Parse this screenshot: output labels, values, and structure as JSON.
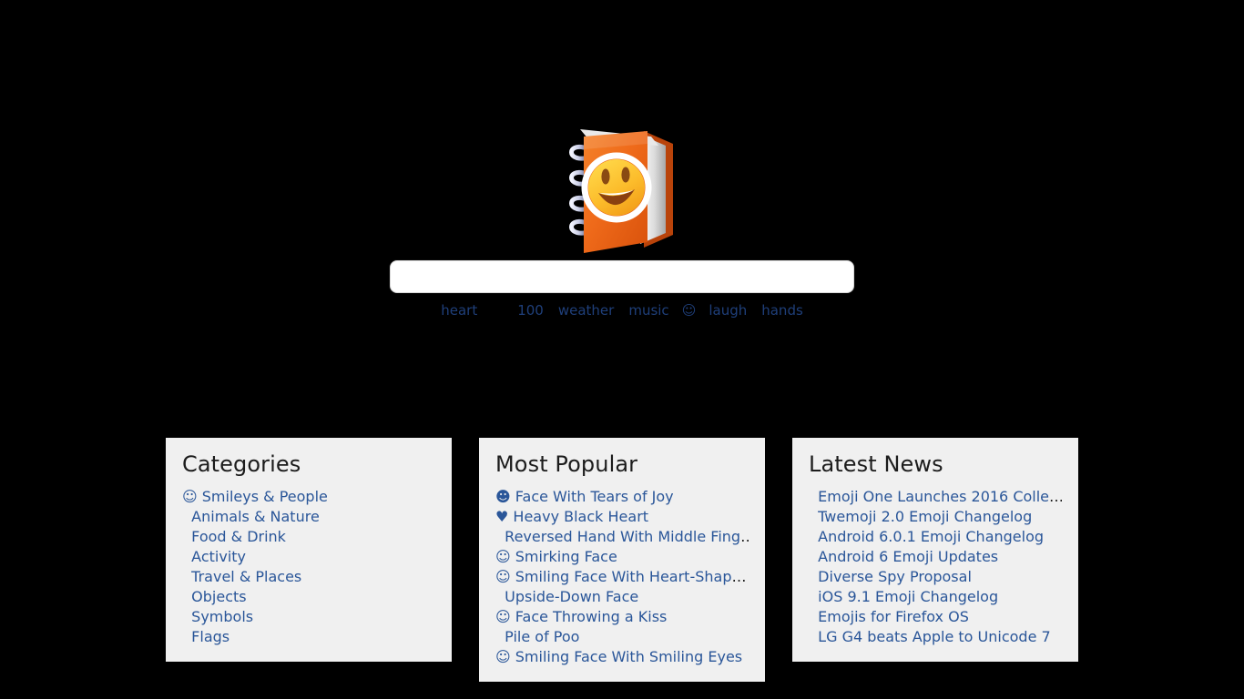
{
  "site": {
    "logo_icon": "notebook-with-decorative-cover-emoji",
    "background_color": "#000000",
    "link_color": "#2a5699",
    "panel_color": "#f0f0f0"
  },
  "search": {
    "value": "",
    "placeholder": "",
    "icon": "search-input"
  },
  "suggested_tags": [
    {
      "label": "heart",
      "kind": "text"
    },
    {
      "label": "",
      "kind": "blank",
      "icon": "missing-glyph"
    },
    {
      "label": "100",
      "kind": "text"
    },
    {
      "label": "weather",
      "kind": "text"
    },
    {
      "label": "music",
      "kind": "text"
    },
    {
      "label": "☺",
      "kind": "glyph",
      "icon": "smirking-face-icon"
    },
    {
      "label": "laugh",
      "kind": "text"
    },
    {
      "label": "hands",
      "kind": "text"
    }
  ],
  "panels": {
    "categories": {
      "title": "Categories",
      "items": [
        {
          "emoji": "☺",
          "label": "Smileys & People",
          "truncated": false
        },
        {
          "emoji": "",
          "label": "Animals & Nature",
          "truncated": false
        },
        {
          "emoji": "",
          "label": "Food & Drink",
          "truncated": false
        },
        {
          "emoji": "",
          "label": "Activity",
          "truncated": false
        },
        {
          "emoji": "",
          "label": "Travel & Places",
          "truncated": false
        },
        {
          "emoji": "",
          "label": "Objects",
          "truncated": false
        },
        {
          "emoji": "",
          "label": "Symbols",
          "truncated": false
        },
        {
          "emoji": "",
          "label": "Flags",
          "truncated": false
        }
      ]
    },
    "most_popular": {
      "title": "Most Popular",
      "items": [
        {
          "emoji": "☻",
          "label": "Face With Tears of Joy",
          "truncated": false
        },
        {
          "emoji": "♥",
          "label": "Heavy Black Heart",
          "truncated": false
        },
        {
          "emoji": "",
          "label": "Reversed Hand With Middle Fing",
          "truncated": true
        },
        {
          "emoji": "☺",
          "label": "Smirking Face",
          "truncated": false
        },
        {
          "emoji": "☺",
          "label": "Smiling Face With Heart-Shap",
          "truncated": true
        },
        {
          "emoji": "",
          "label": "Upside-Down Face",
          "truncated": false
        },
        {
          "emoji": "☺",
          "label": "Face Throwing a Kiss",
          "truncated": false
        },
        {
          "emoji": "",
          "label": "Pile of Poo",
          "truncated": false
        },
        {
          "emoji": "☺",
          "label": "Smiling Face With Smiling Eyes",
          "truncated": false
        }
      ]
    },
    "latest_news": {
      "title": "Latest News",
      "items": [
        {
          "emoji": "",
          "label": "Emoji One Launches 2016 Colle",
          "truncated": true
        },
        {
          "emoji": "",
          "label": "Twemoji 2.0 Emoji Changelog",
          "truncated": false
        },
        {
          "emoji": "",
          "label": "Android 6.0.1 Emoji Changelog",
          "truncated": false
        },
        {
          "emoji": "",
          "label": "Android 6 Emoji Updates",
          "truncated": false
        },
        {
          "emoji": "",
          "label": "Diverse Spy Proposal",
          "truncated": false
        },
        {
          "emoji": "",
          "label": "iOS 9.1 Emoji Changelog",
          "truncated": false
        },
        {
          "emoji": "",
          "label": "Emojis for Firefox OS",
          "truncated": false
        },
        {
          "emoji": "",
          "label": "LG G4 beats Apple to Unicode 7",
          "truncated": false
        }
      ]
    }
  }
}
